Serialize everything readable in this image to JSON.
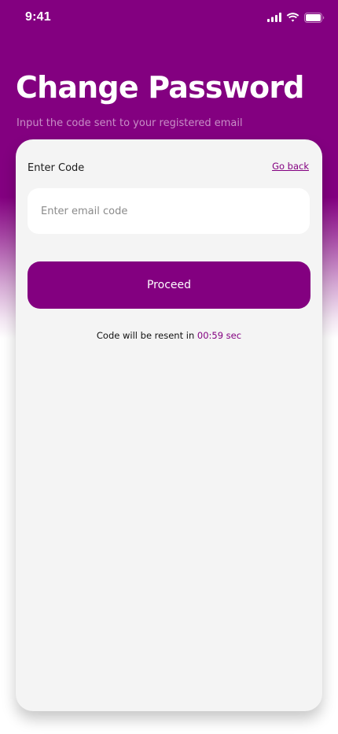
{
  "status_bar": {
    "time": "9:41",
    "icons": [
      "cellular-signal-icon",
      "wifi-icon",
      "battery-icon"
    ]
  },
  "header": {
    "title": "Change Password",
    "subtitle": "Input the code sent to your registered email"
  },
  "form": {
    "code_label": "Enter Code",
    "go_back_label": "Go back",
    "code_input": {
      "placeholder": "Enter email code",
      "value": ""
    },
    "proceed_label": "Proceed",
    "resend_text": "Code will be resent in",
    "countdown": "00:59 sec"
  },
  "colors": {
    "brand": "#830080",
    "card_background": "#f4f4f4",
    "input_background": "#ffffff",
    "text_primary": "#111111"
  }
}
